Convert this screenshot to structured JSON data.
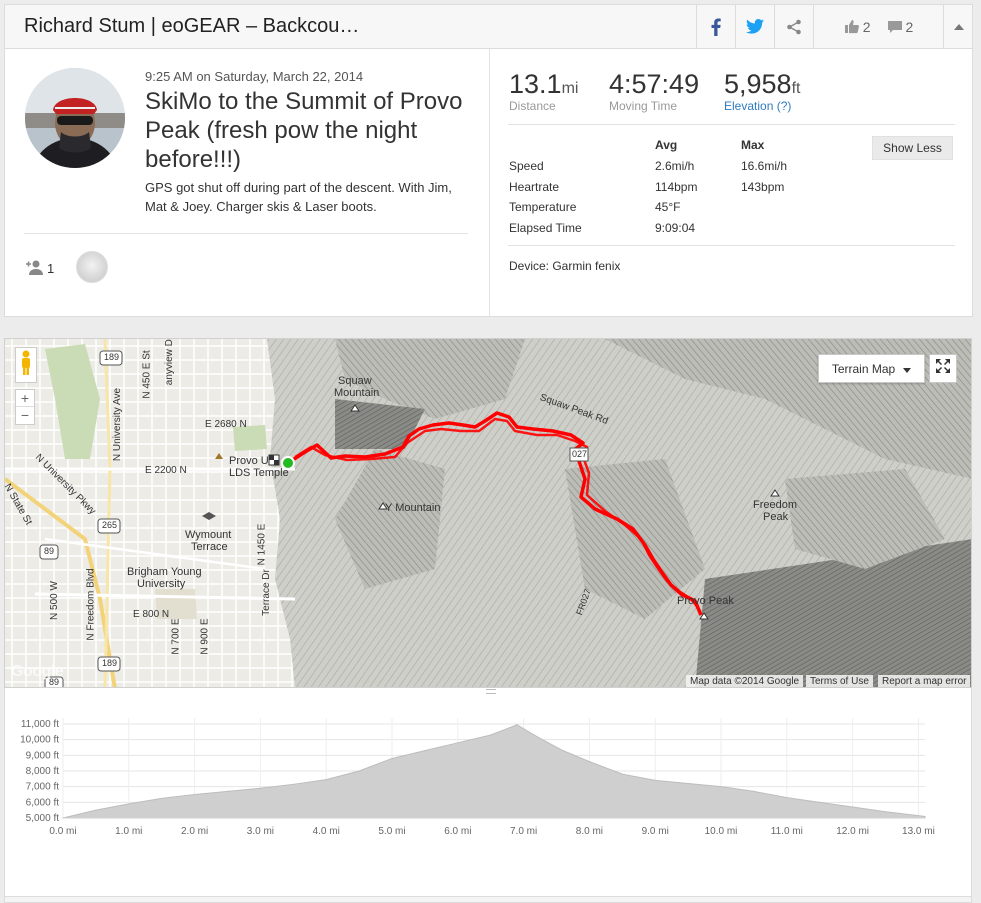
{
  "header": {
    "title": "Richard Stum | eoGEAR – Backcou…",
    "likes": "2",
    "comments": "2"
  },
  "activity": {
    "time": "9:25 AM",
    "on": "on",
    "date": "Saturday, March 22, 2014",
    "title": "SkiMo to the Summit of Provo Peak (fresh pow the night before!!!)",
    "description": "GPS got shut off during part of the descent. With Jim, Mat & Joey. Charger skis & Laser boots.",
    "athletes_count": "1"
  },
  "stats": {
    "distance": {
      "value": "13.1",
      "unit": "mi",
      "label": "Distance"
    },
    "moving_time": {
      "value": "4:57:49",
      "label": "Moving Time"
    },
    "elevation": {
      "value": "5,958",
      "unit": "ft",
      "label": "Elevation (?)"
    },
    "show_less": "Show Less",
    "columns": {
      "avg": "Avg",
      "max": "Max"
    },
    "rows": [
      {
        "label": "Speed",
        "avg": "2.6mi/h",
        "max": "16.6mi/h"
      },
      {
        "label": "Heartrate",
        "avg": "114bpm",
        "max": "143bpm"
      },
      {
        "label": "Temperature",
        "avg": "45°F",
        "max": ""
      },
      {
        "label": "Elapsed Time",
        "avg": "9:09:04",
        "max": ""
      }
    ],
    "device": "Device: Garmin fenix"
  },
  "map": {
    "map_type": "Terrain Map",
    "labels": {
      "squaw_mountain_1": "Squaw",
      "squaw_mountain_2": "Mountain",
      "squaw_peak": "Squaw Peak Rd",
      "y_mountain": "Y Mountain",
      "freedom_peak_1": "Freedom",
      "freedom_peak_2": "Peak",
      "provo_peak": "Provo Peak",
      "temple_1": "Provo U",
      "temple_2": "LDS Temple",
      "e2680": "E 2680 N",
      "e2200": "E 2200 N",
      "wymount_1": "Wymount",
      "wymount_2": "Terrace",
      "byu_1": "Brigham Young",
      "byu_2": "University",
      "e800": "E 800 N",
      "n_univ_ave": "N University Ave",
      "n_univ_pkwy": "N University Pkwy",
      "n_state": "N State St",
      "n450e": "N 450 E St",
      "n1450e": "N 1450 E",
      "n900e": "N 900 E",
      "n700e": "N 700 E",
      "n500w": "N 500 W",
      "n_freedom": "N Freedom Blvd",
      "canyonview": "anyview Dr",
      "terrace": "Terrace Dr",
      "r189a": "189",
      "r189b": "189",
      "r189c": "189",
      "r265": "265",
      "r89a": "89",
      "r89b": "89",
      "r027": "027",
      "fr027": "FR027"
    },
    "attribution": {
      "data": "Map data ©2014 Google",
      "terms": "Terms of Use",
      "report": "Report a map error"
    },
    "google": "Google"
  },
  "chart_data": {
    "type": "area",
    "xlabel": "",
    "ylabel": "",
    "x_ticks": [
      "0.0 mi",
      "1.0 mi",
      "2.0 mi",
      "3.0 mi",
      "4.0 mi",
      "5.0 mi",
      "6.0 mi",
      "7.0 mi",
      "8.0 mi",
      "9.0 mi",
      "10.0 mi",
      "11.0 mi",
      "12.0 mi",
      "13.0 mi"
    ],
    "y_ticks": [
      "5,000 ft",
      "6,000 ft",
      "7,000 ft",
      "8,000 ft",
      "9,000 ft",
      "10,000 ft",
      "11,000 ft"
    ],
    "xlim": [
      0,
      13.1
    ],
    "ylim": [
      5000,
      11000
    ],
    "grid": true,
    "x": [
      0,
      0.5,
      1.0,
      1.5,
      2.0,
      2.5,
      3.0,
      3.5,
      4.0,
      4.5,
      5.0,
      5.5,
      6.0,
      6.5,
      6.9,
      7.2,
      7.6,
      8.0,
      8.5,
      9.0,
      9.5,
      10.0,
      10.5,
      11.0,
      11.5,
      12.0,
      12.5,
      13.1
    ],
    "y": [
      5000,
      5500,
      5900,
      6250,
      6500,
      6700,
      6900,
      7150,
      7450,
      8000,
      8800,
      9300,
      9800,
      10300,
      10950,
      10200,
      9300,
      8600,
      7800,
      7400,
      7200,
      7000,
      6700,
      6300,
      6000,
      5700,
      5400,
      5100
    ]
  },
  "colors": {
    "route": "#ff0000",
    "start_marker": "#22bb22",
    "link": "#2f7bbf",
    "twitter": "#1da1f2",
    "facebook": "#3b5998",
    "elevation_fill": "#cfcfcf"
  }
}
